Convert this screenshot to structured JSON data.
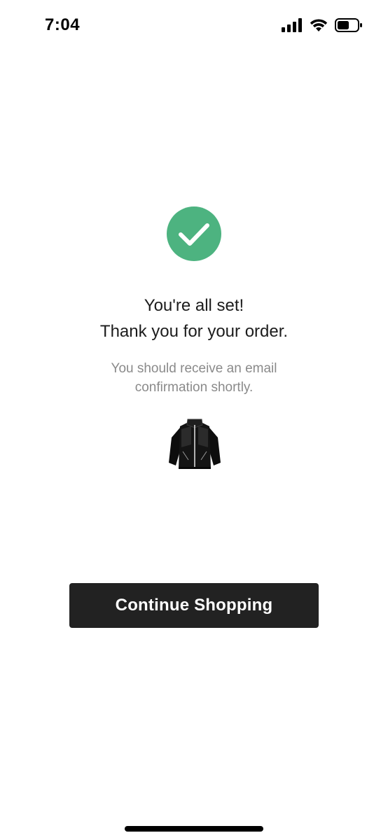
{
  "status_bar": {
    "time": "7:04",
    "icons": [
      "cellular-signal-icon",
      "wifi-icon",
      "battery-icon"
    ]
  },
  "confirmation": {
    "icon": "checkmark-circle-icon",
    "icon_color": "#4db380",
    "headline_line1": "You're all set!",
    "headline_line2": "Thank you for your order.",
    "subtext_line1": "You should receive an email",
    "subtext_line2": "confirmation shortly.",
    "product_image": "black-jacket-image"
  },
  "actions": {
    "continue_label": "Continue Shopping",
    "button_color": "#222222"
  }
}
